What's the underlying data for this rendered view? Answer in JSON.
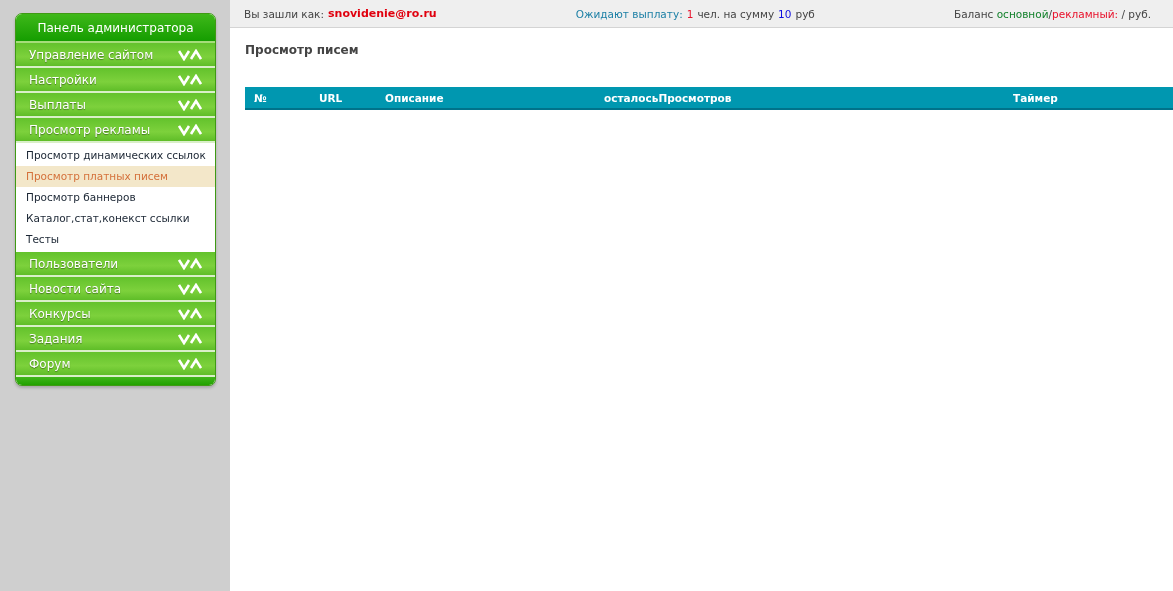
{
  "sidebar": {
    "title": "Панель администратора",
    "sections": [
      {
        "label": "Управление сайтом"
      },
      {
        "label": "Настройки"
      },
      {
        "label": "Выплаты"
      },
      {
        "label": "Просмотр рекламы",
        "children": [
          {
            "label": "Просмотр динамических ссылок",
            "selected": false
          },
          {
            "label": "Просмотр платных писем",
            "selected": true
          },
          {
            "label": "Просмотр баннеров",
            "selected": false
          },
          {
            "label": "Каталог,стат,конекст ссылки",
            "selected": false
          },
          {
            "label": "Тесты",
            "selected": false
          }
        ]
      },
      {
        "label": "Пользователи"
      },
      {
        "label": "Новости сайта"
      },
      {
        "label": "Конкурсы"
      },
      {
        "label": "Задания"
      },
      {
        "label": "Форум"
      }
    ]
  },
  "user_bar": {
    "login_label": "Вы зашли как:",
    "login": "snovidenie@ro.ru",
    "payout_label": "Ожидают выплату:",
    "payout_count": "1",
    "payout_mid": "чел. на сумму",
    "payout_sum": "10",
    "payout_unit": "руб",
    "balance_label": "Баланс",
    "balance_main": "основной",
    "balance_sep": "/",
    "balance_ad": "рекламный:",
    "balance_tail": "/ руб."
  },
  "page_title": "Просмотр писем",
  "table": {
    "columns": [
      "№",
      "URL",
      "Описание",
      "осталосьПросмотров",
      "Таймер"
    ]
  }
}
